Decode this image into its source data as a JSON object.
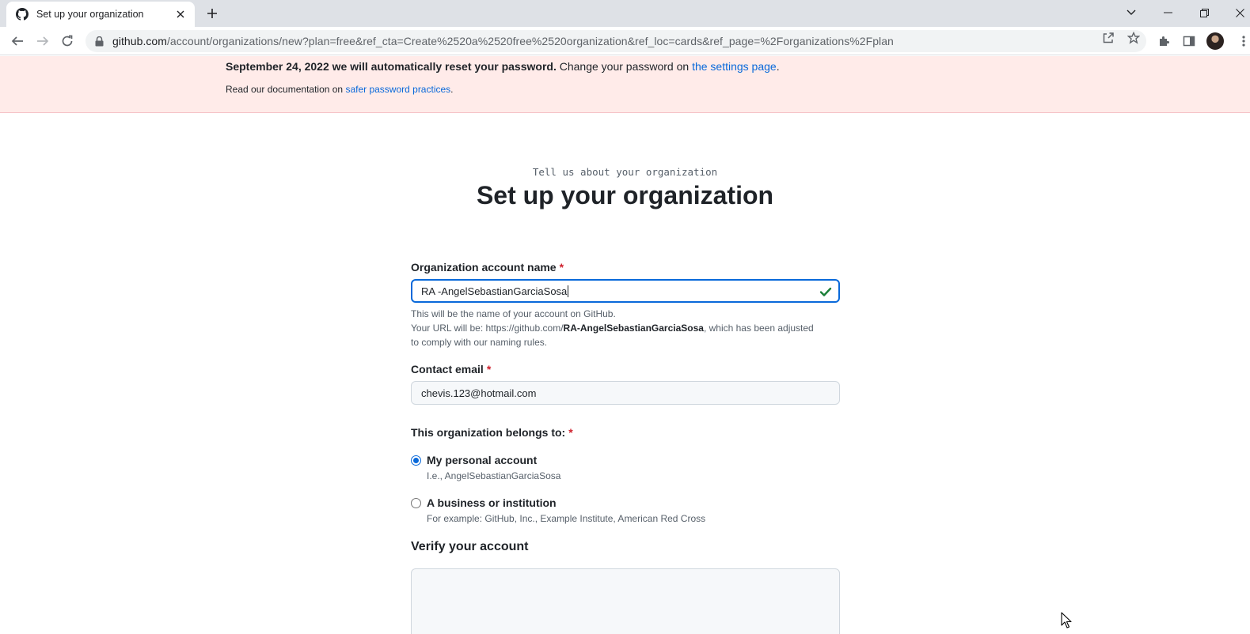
{
  "browser": {
    "tab_title": "Set up your organization",
    "url_host": "github.com",
    "url_path": "/account/organizations/new?plan=free&ref_cta=Create%2520a%2520free%2520organization&ref_loc=cards&ref_page=%2Forganizations%2Fplan"
  },
  "flash": {
    "line1_bold": "September 24, 2022 we will automatically reset your password.",
    "line1_text": " Change your password on ",
    "line1_link": "the settings page",
    "line1_end": ".",
    "line2_text": "Read our documentation on ",
    "line2_link": "safer password practices",
    "line2_end": "."
  },
  "header": {
    "subtitle": "Tell us about your organization",
    "title": "Set up your organization"
  },
  "form": {
    "org_name_label": "Organization account name",
    "org_name_value": "RA -AngelSebastianGarciaSosa",
    "org_name_note1": "This will be the name of your account on GitHub.",
    "org_name_note2_prefix": "Your URL will be: https://github.com/",
    "org_name_note2_bold": "RA-AngelSebastianGarciaSosa",
    "org_name_note2_suffix": ", which has been adjusted to comply with our naming rules.",
    "email_label": "Contact email",
    "email_value": "chevis.123@hotmail.com",
    "belongs_label": "This organization belongs to:",
    "option_personal_label": "My personal account",
    "option_personal_sub": "I.e., AngelSebastianGarciaSosa",
    "option_personal_selected": true,
    "option_business_label": "A business or institution",
    "option_business_sub": "For example: GitHub, Inc., Example Institute, American Red Cross",
    "required_mark": "*",
    "verify_title": "Verify your account"
  },
  "colors": {
    "accent": "#0969da",
    "flash_bg": "#ffebe9",
    "success": "#1a7f37",
    "required": "#cf222e"
  }
}
